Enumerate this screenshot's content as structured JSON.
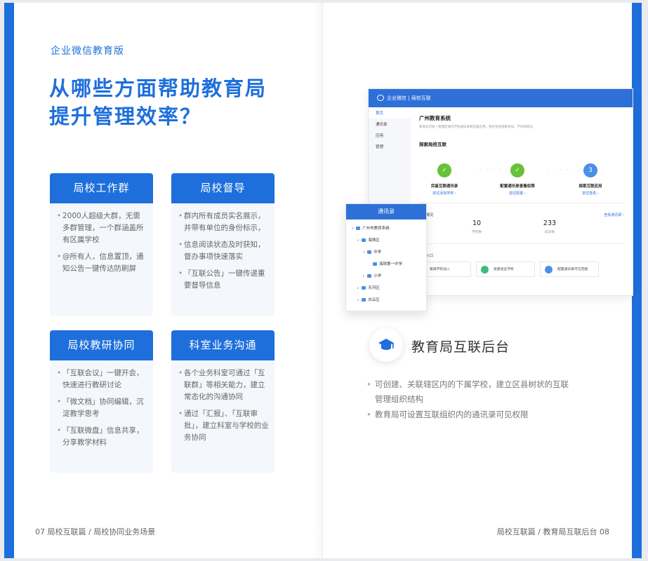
{
  "left": {
    "tag": "企业微信教育版",
    "title_line1": "从哪些方面帮助教育局",
    "title_line2": "提升管理效率？",
    "cards": [
      {
        "title": "局校工作群",
        "bullets": [
          "2000人超级大群，无需多群管理，一个群涵盖所有区属学校",
          "@所有人，信息置顶，通知公告一键传达防刷屏"
        ]
      },
      {
        "title": "局校督导",
        "bullets": [
          "群内所有成员实名展示，并带有单位的身份标示，",
          "信息阅读状态及时获知，督办事项快速落实",
          "「互联公告」一键传递重要督导信息"
        ]
      },
      {
        "title": "局校教研协同",
        "bullets": [
          "「互联会议」一键开会，快速进行教研讨论",
          "「微文档」协同编辑，沉淀教学思考",
          "「互联微盘」信息共享，分享教学材料"
        ]
      },
      {
        "title": "科室业务沟通",
        "bullets": [
          "各个业务科室可通过「互联群」等相关能力，建立常态化的沟通协同",
          "通过「汇报」、「互联审批」，建立科室与学校的业务协同"
        ]
      }
    ],
    "footer": "07  局校互联篇 / 局校协同业务场景"
  },
  "mock": {
    "topbar": "企业微信  |  局校互联",
    "side": [
      "首页",
      "通讯录",
      "应用",
      "管理"
    ],
    "org_title": "广州教育系统",
    "org_desc": "教育局可统一管理区域内学校通讯录和互联应用，更好地连接教育局、学校和家长。",
    "section": "探索局校互联",
    "steps": [
      {
        "mark": "✓",
        "title": "完善互联通讯录",
        "link": "前往添加学校 ›"
      },
      {
        "mark": "✓",
        "title": "配置通讯录查看权限",
        "link": "前往配置 ›"
      },
      {
        "mark": "3",
        "title": "探索互联应用",
        "link": "前往查看 ›"
      }
    ],
    "overview_label": "互联概况",
    "overview_link": "查看通讯录 ›",
    "stats": [
      {
        "value": "10",
        "label": "学校数"
      },
      {
        "value": "233",
        "label": "成员数"
      }
    ],
    "quick_label": "常用入口",
    "quick": [
      "邀请学校加入",
      "批量验证学校",
      "配置通讯录可见范围"
    ]
  },
  "tree": {
    "title": "通讯录",
    "nodes": [
      "广州市教育系统",
      "海珠区",
      "中学",
      "海珠第一中学",
      "小学",
      "天河区",
      "白云区"
    ]
  },
  "right": {
    "feature_title": "教育局互联后台",
    "bullets": [
      "可创建、关联辖区内的下属学校，建立区县树状的互联管理组织结构",
      "教育局可设置互联组织内的通讯录可见权限"
    ],
    "footer": "局校互联篇 / 教育局互联后台  08"
  },
  "colors": {
    "brand": "#1e6fdc",
    "success": "#67c23a"
  }
}
